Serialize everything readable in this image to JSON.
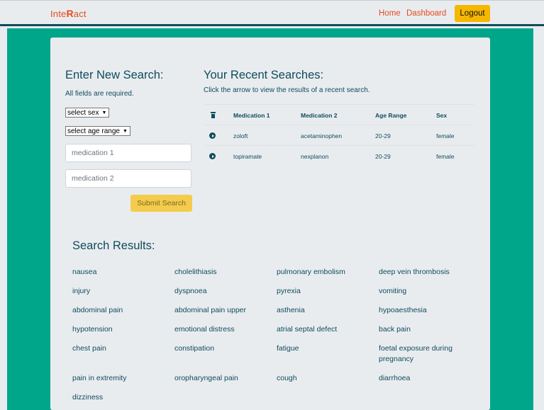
{
  "nav": {
    "brand_prefix": "Inte",
    "brand_rx": "R",
    "brand_suffix": "act",
    "home": "Home",
    "dashboard": "Dashboard",
    "logout": "Logout"
  },
  "new_search": {
    "title": "Enter New Search:",
    "required": "All fields are required.",
    "sex_select": "select sex",
    "age_select": "select age range",
    "med1_placeholder": "medication 1",
    "med2_placeholder": "medication 2",
    "submit": "Submit Search"
  },
  "recent": {
    "title": "Your Recent Searches:",
    "subtitle": "Click the arrow to view the results of a recent search.",
    "headers": [
      "Medication 1",
      "Medication 2",
      "Age Range",
      "Sex"
    ],
    "rows": [
      [
        "zoloft",
        "acetaminophen",
        "20-29",
        "female"
      ],
      [
        "topiramate",
        "nexplanon",
        "20-29",
        "female"
      ]
    ]
  },
  "results": {
    "title": "Search Results:",
    "items": [
      "nausea",
      "cholelithiasis",
      "pulmonary embolism",
      "deep vein thrombosis",
      "injury",
      "dyspnoea",
      "pyrexia",
      "vomiting",
      "abdominal pain",
      "abdominal pain upper",
      "asthenia",
      "hypoaesthesia",
      "hypotension",
      "emotional distress",
      "atrial septal defect",
      "back pain",
      "chest pain",
      "constipation",
      "fatigue",
      "foetal exposure during pregnancy",
      "pain in extremity",
      "oropharyngeal pain",
      "cough",
      "diarrhoea",
      "dizziness"
    ]
  },
  "colors": {
    "accent_orange": "#e8491d",
    "teal": "#00a68a",
    "navy": "#0f4c5c",
    "button_yellow": "#f5b701"
  }
}
